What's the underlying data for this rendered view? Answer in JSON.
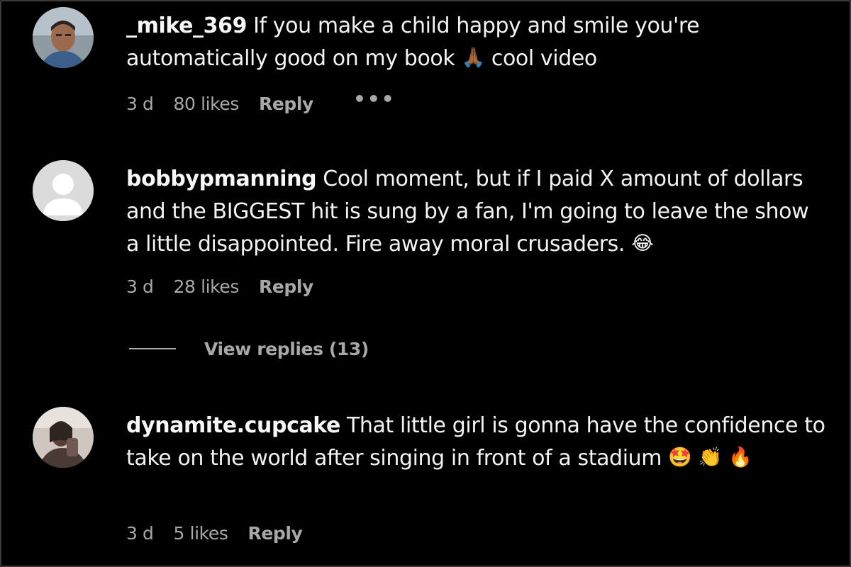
{
  "comments": [
    {
      "username": "_mike_369",
      "text_part1": "If you make a child happy and smile you're automatically good on my book",
      "emoji1": "🙏🏾",
      "text_part2": "cool video",
      "time": "3 d",
      "likes": "80 likes",
      "reply_label": "Reply",
      "more_label": "•••",
      "avatar_icon": "user-photo-avatar"
    },
    {
      "username": "bobbypmanning",
      "text_part1": "Cool moment, but if I paid X amount of dollars and the BIGGEST hit is sung by a fan, I'm going to leave the show a little disappointed. Fire away moral crusaders.",
      "emoji1": "😂",
      "time": "3 d",
      "likes": "28 likes",
      "reply_label": "Reply",
      "avatar_icon": "default-user-avatar",
      "view_replies": "View replies (13)"
    },
    {
      "username": "dynamite.cupcake",
      "text_part1": "That little girl is gonna have the confidence to take on the world after singing in front of a stadium",
      "emoji1": "🤩",
      "emoji2": "👏",
      "emoji3": "🔥",
      "time": "3 d",
      "likes": "5 likes",
      "reply_label": "Reply",
      "avatar_icon": "user-photo-avatar"
    }
  ],
  "colors": {
    "background": "#000000",
    "text": "#f3f3f3",
    "secondary": "#a8a8a8",
    "frame": "#3a3a3a"
  }
}
